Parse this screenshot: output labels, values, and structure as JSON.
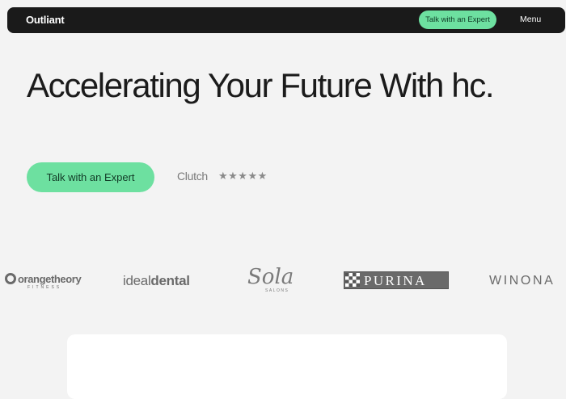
{
  "header": {
    "brand": "Outliant",
    "cta_label": "Talk with an Expert",
    "menu_label": "Menu"
  },
  "hero": {
    "headline": "Accelerating Your Future With hc.",
    "cta_label": "Talk with an Expert",
    "rating_source": "Clutch",
    "rating_stars": "★★★★★",
    "rating_value": 5
  },
  "client_logos": {
    "orangetheory": {
      "word": "orangetheory",
      "sub": "FITNESS"
    },
    "ideal_dental": {
      "word_light": "ideal",
      "word_bold": "dental"
    },
    "sola": {
      "word": "Sola",
      "sub": "SALONS"
    },
    "purina": {
      "word": "PURINA"
    },
    "winona": {
      "word": "WINONA"
    }
  },
  "colors": {
    "accent": "#6de0a0",
    "topbar": "#1a1a1a",
    "background": "#f3f3f3"
  }
}
